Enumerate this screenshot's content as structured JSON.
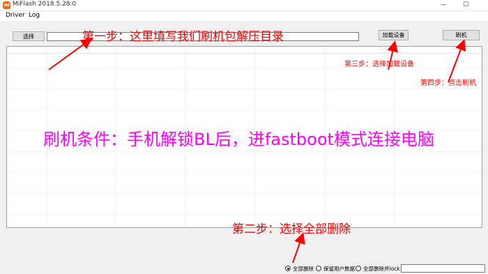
{
  "window": {
    "title": "MiFlash 2018.5.28.0",
    "icon": "mi-logo",
    "icon_text": "mi",
    "minimize": "—",
    "maximize": "☐"
  },
  "menu": {
    "items": [
      "Driver",
      "Log"
    ]
  },
  "toolbar": {
    "select_label": "选择",
    "path_value": "",
    "refresh_label": "加载设备",
    "flash_label": "刷机"
  },
  "annotations": {
    "step1": "第一步：这里填写我们刷机包解压目录",
    "step2": "第二步：选择全部删除",
    "step3": "第三步：选择加载设备",
    "step4": "第四步：点击刷机",
    "condition": "刷机条件：手机解锁BL后，进fastboot模式连接电脑",
    "annotation_color": "#ff0000",
    "condition_color": "#ff00ff"
  },
  "options": {
    "selected": "全部删除",
    "items": [
      "全部删除",
      "保留用户数据",
      "全部删除并lock"
    ]
  },
  "status": {
    "value": ""
  }
}
